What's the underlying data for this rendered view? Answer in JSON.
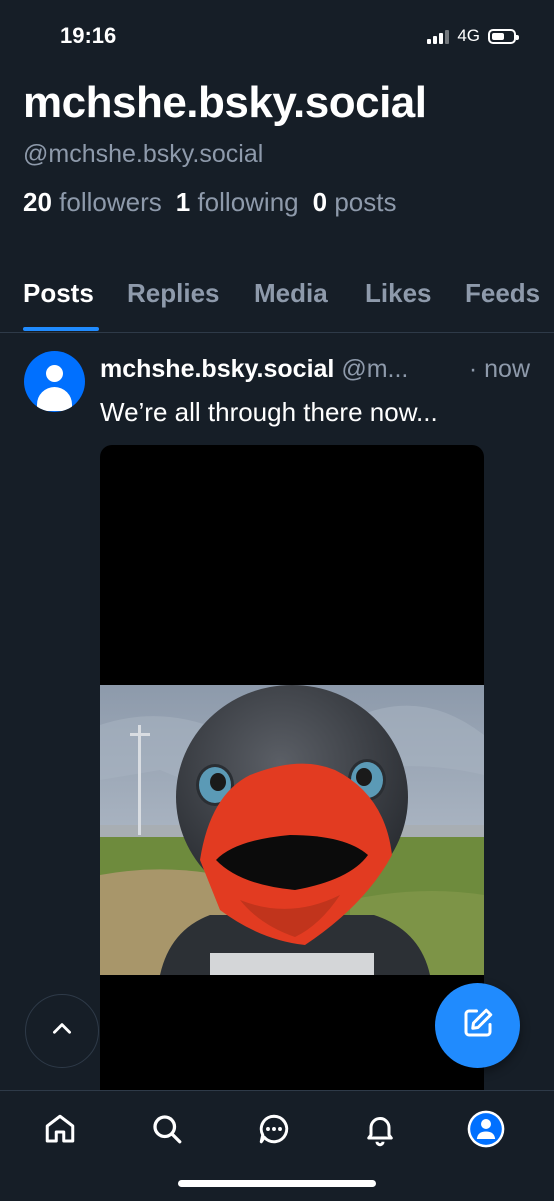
{
  "status_bar": {
    "time": "19:16",
    "network": "4G"
  },
  "profile": {
    "display_name": "mchshe.bsky.social",
    "handle": "@mchshe.bsky.social",
    "followers_count": "20",
    "followers_label": "followers",
    "following_count": "1",
    "following_label": "following",
    "posts_count": "0",
    "posts_label": "posts"
  },
  "tabs": [
    {
      "label": "Posts",
      "active": true
    },
    {
      "label": "Replies"
    },
    {
      "label": "Media"
    },
    {
      "label": "Likes"
    },
    {
      "label": "Feeds"
    }
  ],
  "post": {
    "author": "mchshe.bsky.social",
    "handle": "@m...",
    "time": "· now",
    "text": "We’re all through there now..."
  },
  "icons": {
    "scroll_top": "chevron-up-icon",
    "compose": "pencil-square-icon",
    "nav": [
      "home-icon",
      "search-icon",
      "chat-icon",
      "bell-icon",
      "profile-icon"
    ]
  },
  "colors": {
    "accent": "#208bfe",
    "background": "#161e27",
    "muted": "#8e9aab"
  }
}
